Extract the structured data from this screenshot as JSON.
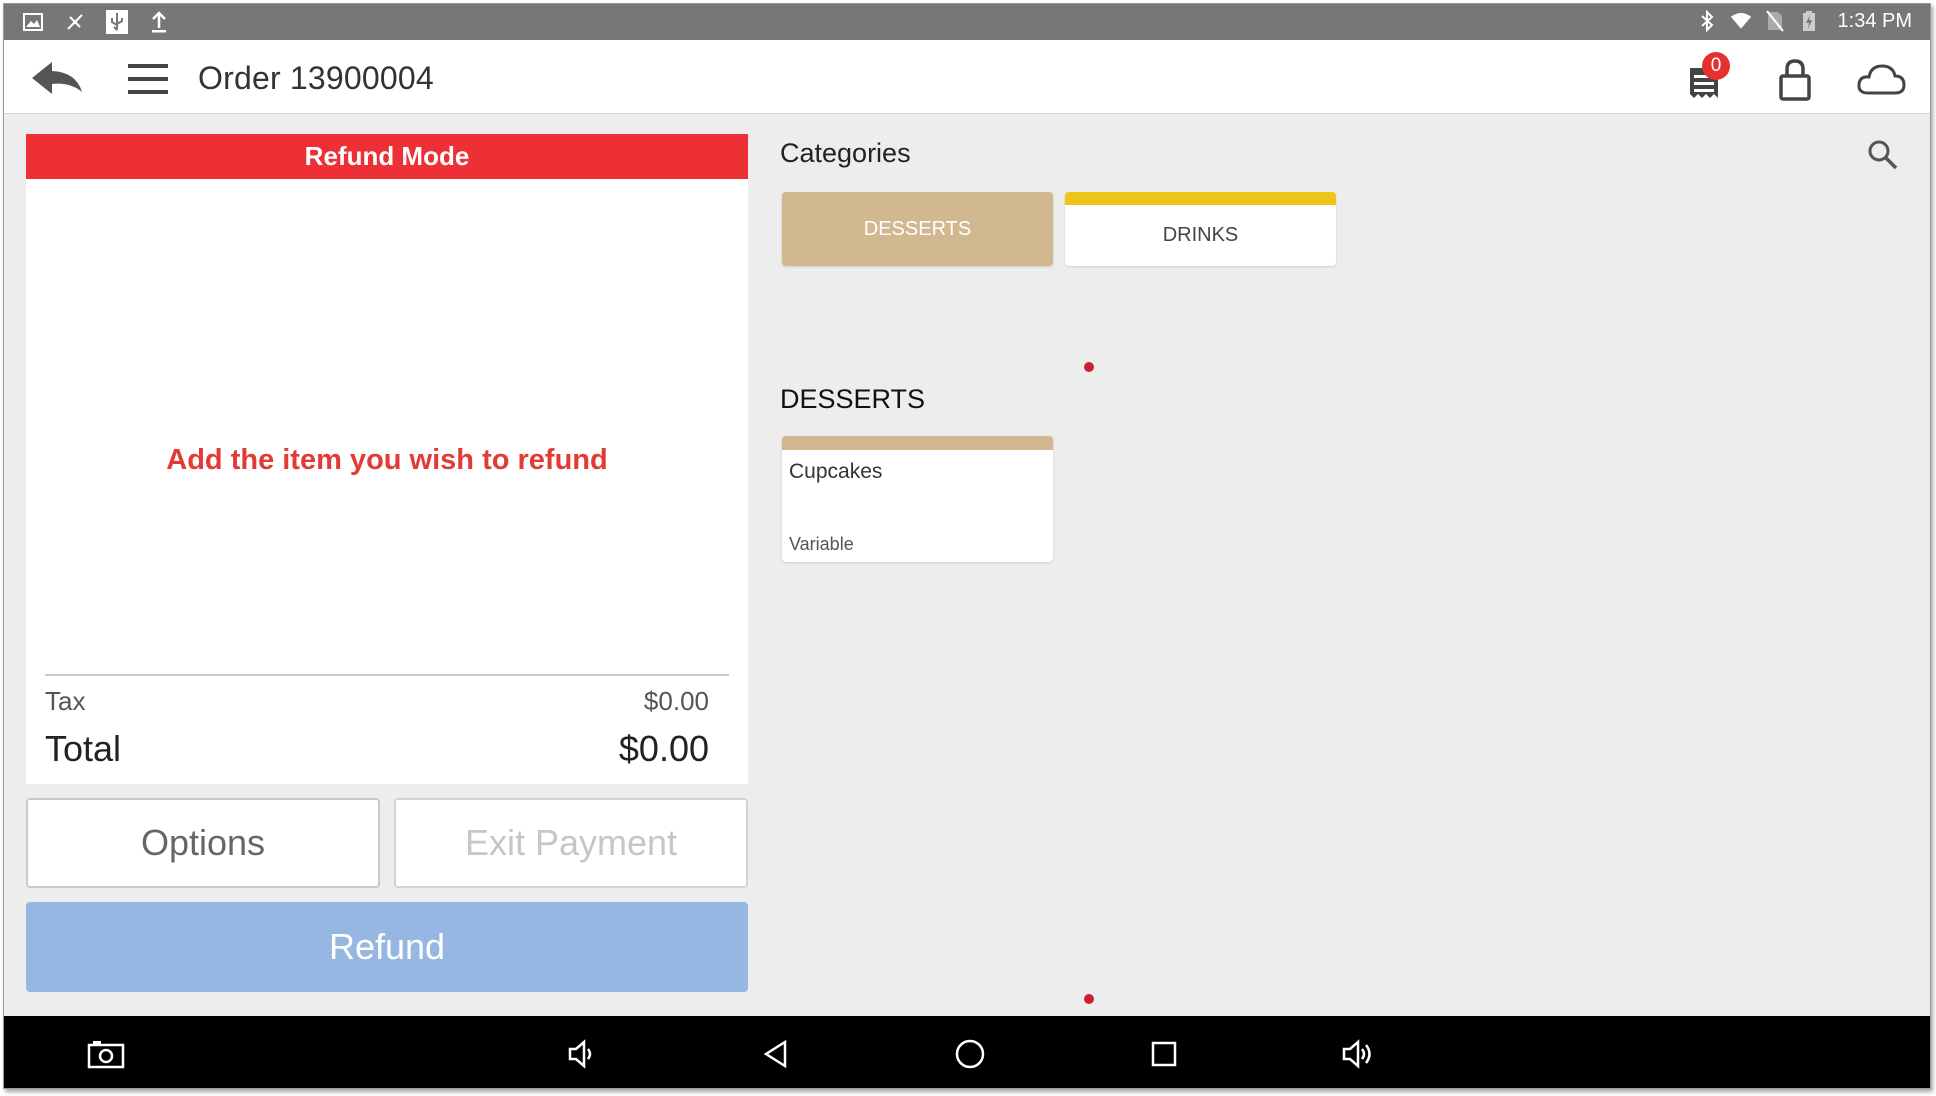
{
  "status_bar": {
    "time": "1:34 PM",
    "left_icons": [
      "image-icon",
      "signal-off-icon",
      "usb-icon",
      "upload-icon"
    ],
    "right_icons": [
      "bluetooth-icon",
      "wifi-icon",
      "no-sim-icon",
      "battery-charging-icon"
    ]
  },
  "app_bar": {
    "title": "Order 13900004",
    "receipt_badge": "0"
  },
  "ticket": {
    "banner": "Refund Mode",
    "hint": "Add the item you wish to refund",
    "tax_label": "Tax",
    "tax_value": "$0.00",
    "total_label": "Total",
    "total_value": "$0.00"
  },
  "buttons": {
    "options": "Options",
    "exit_payment": "Exit Payment",
    "refund": "Refund"
  },
  "catalog": {
    "categories_heading": "Categories",
    "categories": [
      {
        "label": "DESSERTS",
        "color": "#d2b890",
        "selected": true
      },
      {
        "label": "DRINKS",
        "color": "#f0c519",
        "selected": false
      }
    ],
    "section_heading": "DESSERTS",
    "items": [
      {
        "name": "Cupcakes",
        "price_type": "Variable",
        "color": "#d2b890"
      }
    ]
  },
  "colors": {
    "refund_red": "#ec3035",
    "refund_button": "#95b7e2",
    "badge_red": "#e53030"
  }
}
